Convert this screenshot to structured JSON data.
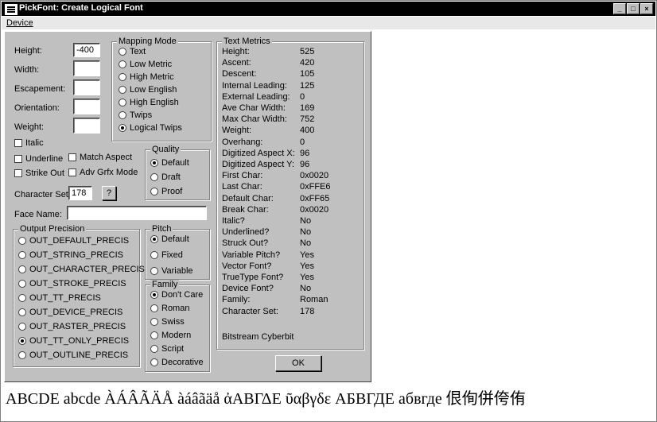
{
  "window": {
    "title": "PickFont: Create Logical Font",
    "menu": [
      "Device"
    ],
    "controls": [
      "minimize",
      "maximize",
      "close"
    ]
  },
  "fields": {
    "height_label": "Height:",
    "height_value": "-400",
    "width_label": "Width:",
    "width_value": "",
    "escapement_label": "Escapement:",
    "escapement_value": "",
    "orientation_label": "Orientation:",
    "orientation_value": "",
    "weight_label": "Weight:",
    "weight_value": "",
    "italic_label": "Italic",
    "underline_label": "Underline",
    "strikeout_label": "Strike Out",
    "match_aspect_label": "Match Aspect",
    "adv_gfx_label": "Adv Grfx Mode",
    "charset_label": "Character Set:",
    "charset_value": "178",
    "charset_button": "?",
    "facename_label": "Face Name:",
    "facename_value": ""
  },
  "mapping_mode": {
    "title": "Mapping Mode",
    "options": [
      "Text",
      "Low Metric",
      "High Metric",
      "Low English",
      "High English",
      "Twips",
      "Logical Twips"
    ],
    "selected": 6
  },
  "quality": {
    "title": "Quality",
    "options": [
      "Default",
      "Draft",
      "Proof"
    ],
    "selected": 0
  },
  "pitch": {
    "title": "Pitch",
    "options": [
      "Default",
      "Fixed",
      "Variable"
    ],
    "selected": 0
  },
  "family": {
    "title": "Family",
    "options": [
      "Don't Care",
      "Roman",
      "Swiss",
      "Modern",
      "Script",
      "Decorative"
    ],
    "selected": 0
  },
  "output_precision": {
    "title": "Output Precision",
    "options": [
      "OUT_DEFAULT_PRECIS",
      "OUT_STRING_PRECIS",
      "OUT_CHARACTER_PRECIS",
      "OUT_STROKE_PRECIS",
      "OUT_TT_PRECIS",
      "OUT_DEVICE_PRECIS",
      "OUT_RASTER_PRECIS",
      "OUT_TT_ONLY_PRECIS",
      "OUT_OUTLINE_PRECIS"
    ],
    "selected": 7
  },
  "text_metrics": {
    "title": "Text Metrics",
    "rows": [
      {
        "label": "Height:",
        "value": "525"
      },
      {
        "label": "Ascent:",
        "value": "420"
      },
      {
        "label": "Descent:",
        "value": "105"
      },
      {
        "label": "Internal Leading:",
        "value": "125"
      },
      {
        "label": "External Leading:",
        "value": "0"
      },
      {
        "label": "Ave Char Width:",
        "value": "169"
      },
      {
        "label": "Max Char Width:",
        "value": "752"
      },
      {
        "label": "Weight:",
        "value": "400"
      },
      {
        "label": "Overhang:",
        "value": "0"
      },
      {
        "label": "Digitized Aspect X:",
        "value": "96"
      },
      {
        "label": "Digitized Aspect Y:",
        "value": "96"
      },
      {
        "label": "First Char:",
        "value": "0x0020"
      },
      {
        "label": "Last Char:",
        "value": "0xFFE6"
      },
      {
        "label": "Default Char:",
        "value": "0xFF65"
      },
      {
        "label": "Break Char:",
        "value": "0x0020"
      },
      {
        "label": "Italic?",
        "value": "No"
      },
      {
        "label": "Underlined?",
        "value": "No"
      },
      {
        "label": "Struck Out?",
        "value": "No"
      },
      {
        "label": "Variable Pitch?",
        "value": "Yes"
      },
      {
        "label": "Vector Font?",
        "value": "Yes"
      },
      {
        "label": "TrueType Font?",
        "value": "Yes"
      },
      {
        "label": "Device Font?",
        "value": "No"
      },
      {
        "label": "Family:",
        "value": "Roman"
      },
      {
        "label": "Character Set:",
        "value": "178"
      }
    ],
    "face_name": "Bitstream Cyberbit"
  },
  "ok_button": "OK",
  "sample_text": "ABCDE abcde ÀÁÂÃÄÅ àáâãäå ἀΑΒΓΔΕ ῦαβγδε АБВГДЕ абвгде 佷侚併侉侑"
}
